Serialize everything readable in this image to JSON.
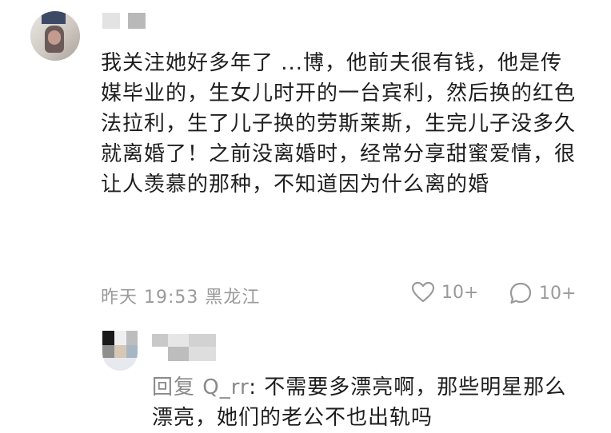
{
  "comment": {
    "text": "我关注她好多年了 ...博，他前夫很有钱，他是传媒毕业的，生女儿时开的一台宾利，然后换的红色法拉利，生了儿子换的劳斯莱斯，生完儿子没多久就离婚了！之前没离婚时，经常分享甜蜜爱情，很让人羡慕的那种，不知道因为什么离的婚",
    "time": "昨天 19:53",
    "location": "黑龙江",
    "like_icon": "heart-icon",
    "like_count": "10+",
    "reply_icon": "comment-bubble-icon",
    "reply_count": "10+"
  },
  "reply": {
    "prefix": "回复",
    "target": "Q_rr",
    "text": ": 不需要多漂亮啊，那些明星那么漂亮，她们的老公不也出轨吗"
  }
}
